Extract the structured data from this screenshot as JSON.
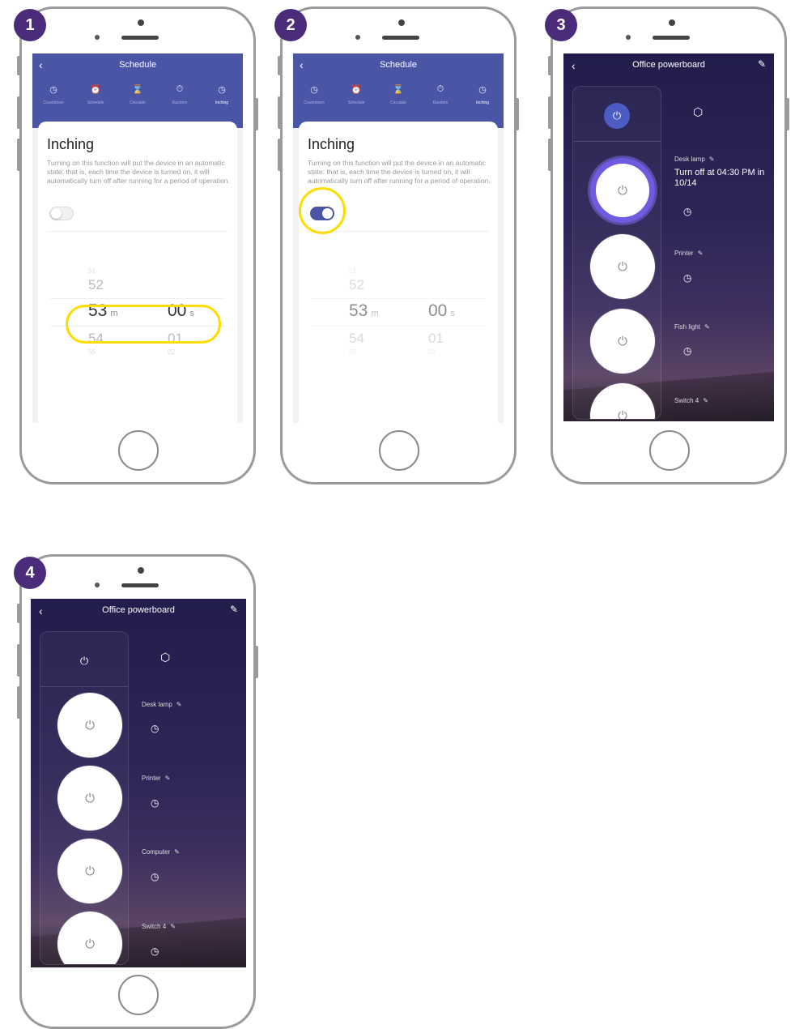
{
  "steps": [
    "1",
    "2",
    "3",
    "4"
  ],
  "schedule": {
    "title": "Schedule",
    "back_icon": "chevron-left-icon",
    "tabs": [
      {
        "label": "Countdown",
        "icon": "clock-icon"
      },
      {
        "label": "Schedule",
        "icon": "alarm-clock-icon"
      },
      {
        "label": "Circulate",
        "icon": "hourglass-icon"
      },
      {
        "label": "Random",
        "icon": "timer-icon"
      },
      {
        "label": "Inching",
        "icon": "inching-clock-icon",
        "active": true
      }
    ],
    "card_title": "Inching",
    "description": "Turning on this function will put the device in an automatic state: that is, each time the device is turned on, it will automatically turn off after running for a period of operation.",
    "picker": {
      "minutes_above2": "51",
      "minutes_above": "52",
      "minutes_selected": "53",
      "minutes_below": "54",
      "minutes_below2": "55",
      "seconds_selected": "00",
      "seconds_below": "01",
      "seconds_below2": "02",
      "minute_unit": "m",
      "second_unit": "s"
    },
    "toggle_screen1": "off",
    "toggle_screen2": "on",
    "highlight_color": "#ffdc00",
    "header_color": "#4a55a6"
  },
  "office": {
    "title": "Office powerboard",
    "master_icon": "power-icon",
    "scene_icon": "cube-icon",
    "screen3": {
      "switches": [
        {
          "name": "Desk lamp",
          "status": "Turn off at 04:30 PM in 10/14",
          "on": true
        },
        {
          "name": "Printer"
        },
        {
          "name": "Fish light"
        },
        {
          "name": "Switch 4"
        }
      ]
    },
    "screen4": {
      "switches": [
        {
          "name": "Desk lamp"
        },
        {
          "name": "Printer"
        },
        {
          "name": "Computer"
        },
        {
          "name": "Switch 4"
        }
      ]
    },
    "accent_color": "#4d5cc4"
  }
}
